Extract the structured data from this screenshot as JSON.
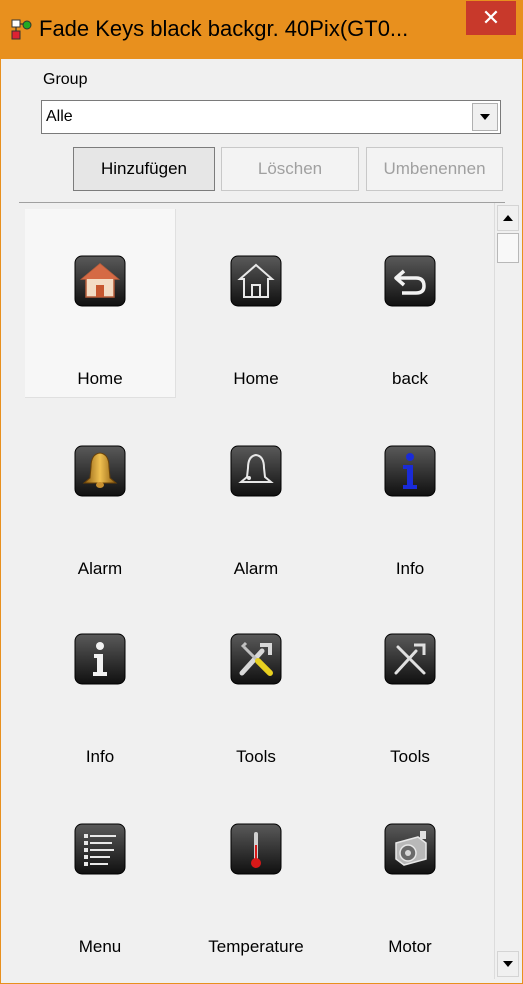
{
  "window": {
    "title": "Fade Keys black backgr. 40Pix(GT0...",
    "close_glyph": "✕",
    "accent_color": "#e8901e"
  },
  "group": {
    "label": "Group",
    "selected": "Alle"
  },
  "buttons": {
    "add": "Hinzufügen",
    "delete": "Löschen",
    "rename": "Umbenennen"
  },
  "items": [
    {
      "label": "Home",
      "icon": "home-color-icon",
      "selected": true
    },
    {
      "label": "Home",
      "icon": "home-outline-icon"
    },
    {
      "label": "back",
      "icon": "back-arrow-icon"
    },
    {
      "label": "Alarm",
      "icon": "bell-color-icon"
    },
    {
      "label": "Alarm",
      "icon": "bell-outline-icon"
    },
    {
      "label": "Info",
      "icon": "info-blue-icon"
    },
    {
      "label": "Info",
      "icon": "info-white-icon"
    },
    {
      "label": "Tools",
      "icon": "tools-color-icon"
    },
    {
      "label": "Tools",
      "icon": "tools-outline-icon"
    },
    {
      "label": "Menu",
      "icon": "menu-list-icon"
    },
    {
      "label": "Temperature",
      "icon": "thermometer-icon"
    },
    {
      "label": "Motor",
      "icon": "motor-icon"
    }
  ]
}
